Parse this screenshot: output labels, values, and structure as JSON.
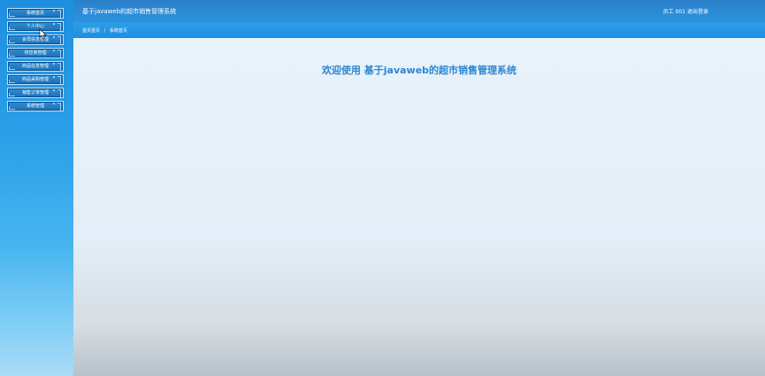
{
  "header": {
    "title": "基于javaweb的超市销售管理系统",
    "user": "员工 001",
    "logout": "退出登录"
  },
  "breadcrumb": {
    "home": "首页首页",
    "separator": "/",
    "current": "系统首页"
  },
  "sidebar": {
    "items": [
      {
        "label": "系统首页"
      },
      {
        "label": "个人中心"
      },
      {
        "label": "会员信息管理"
      },
      {
        "label": "供应商管理"
      },
      {
        "label": "商品信息管理"
      },
      {
        "label": "商品采购管理"
      },
      {
        "label": "销售订单管理"
      },
      {
        "label": "系统管理"
      }
    ]
  },
  "main": {
    "welcome": "欢迎使用 基于javaweb的超市销售管理系统"
  },
  "colors": {
    "header": "#2c7fc9",
    "breadcrumb": "#1e8ee0",
    "welcome_text": "#2b86d1",
    "menu_item": "#1f6fb7"
  },
  "icons": {
    "cursor": "mouse-pointer-icon"
  }
}
